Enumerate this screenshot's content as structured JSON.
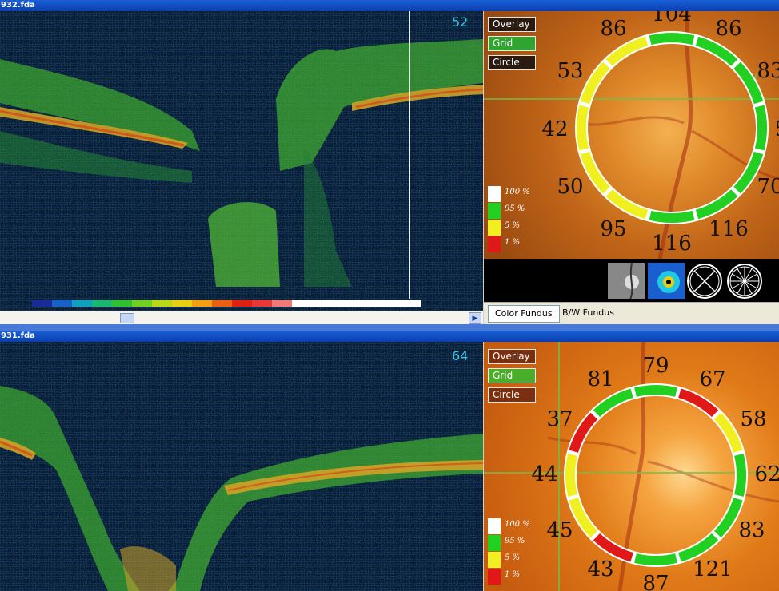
{
  "top_panel": {
    "title": "932.fda",
    "slice_number": "52",
    "toggles": {
      "overlay": "Overlay",
      "grid": "Grid",
      "circle": "Circle"
    },
    "legend": [
      "100 %",
      "95 %",
      "5 %",
      "1 %"
    ],
    "sectors": [
      "104",
      "86",
      "83",
      "5",
      "70",
      "116",
      "116",
      "95",
      "50",
      "42",
      "53",
      "86"
    ],
    "tabs": {
      "color_fundus": "Color Fundus",
      "bw_fundus": "B/W Fundus"
    }
  },
  "bottom_panel": {
    "title": "931.fda",
    "slice_number": "64",
    "toggles": {
      "overlay": "Overlay",
      "grid": "Grid",
      "circle": "Circle"
    },
    "legend": [
      "100 %",
      "95 %",
      "5 %",
      "1 %"
    ],
    "sectors": [
      "79",
      "67",
      "58",
      "62",
      "83",
      "121",
      "87",
      "43",
      "45",
      "44",
      "37",
      "81"
    ]
  },
  "colors": {
    "normal": "#22d022",
    "borderline": "#f0f020",
    "outside": "#e01818",
    "above": "#ffffff",
    "grid_active": "#2fa52f",
    "oct_bg": "#071233"
  },
  "icons": [
    "fundus-thumbnail-icon",
    "thickness-map-icon",
    "quadrant-grid-icon",
    "clock-hour-grid-icon"
  ]
}
